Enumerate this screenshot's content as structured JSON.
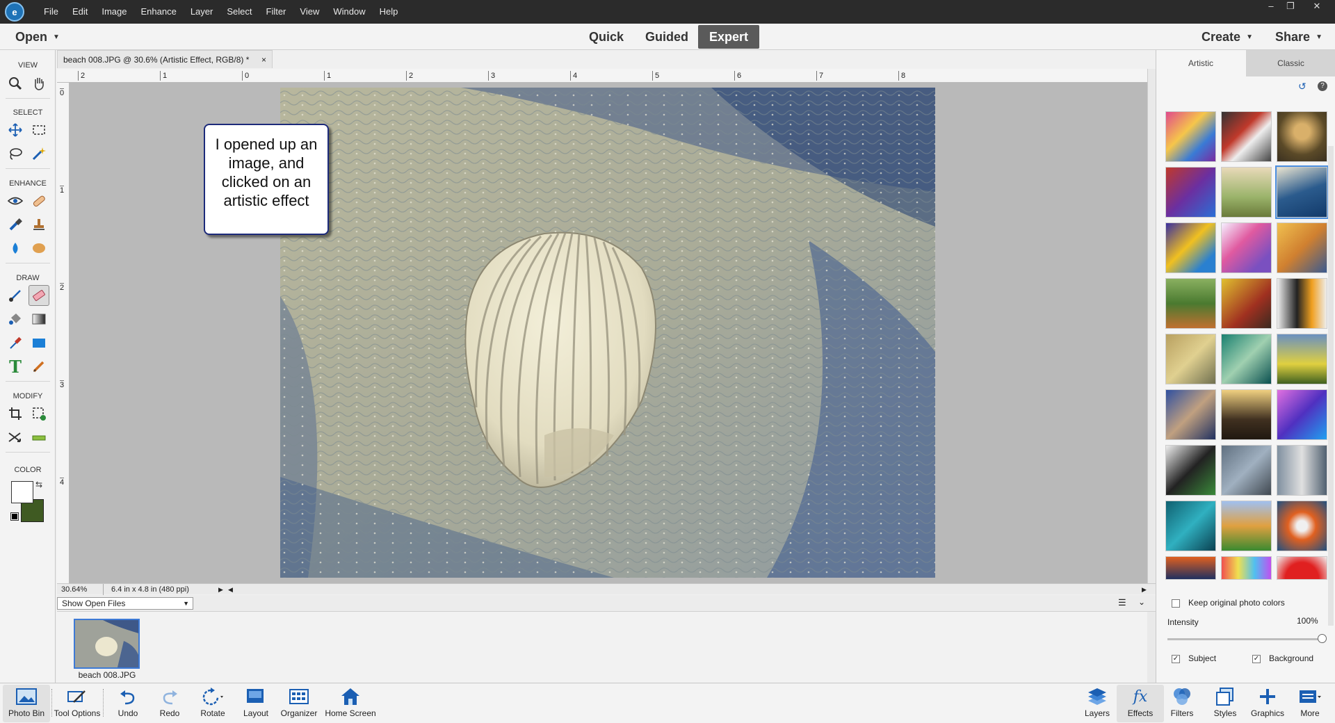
{
  "app": {
    "logo_text": "e"
  },
  "menu": [
    "File",
    "Edit",
    "Image",
    "Enhance",
    "Layer",
    "Select",
    "Filter",
    "View",
    "Window",
    "Help"
  ],
  "window_controls": [
    "–",
    "❐",
    "✕"
  ],
  "modebar": {
    "open_label": "Open",
    "modes": [
      "Quick",
      "Guided",
      "Expert"
    ],
    "active_mode": "Expert",
    "create_label": "Create",
    "share_label": "Share"
  },
  "toolbox": {
    "sections": [
      "VIEW",
      "SELECT",
      "ENHANCE",
      "DRAW",
      "MODIFY",
      "COLOR"
    ],
    "foreground_color": "#ffffff",
    "background_color": "#3f5a22"
  },
  "document": {
    "tab_title": "beach 008.JPG @ 30.6% (Artistic Effect, RGB/8) *",
    "close": "×"
  },
  "rulers": {
    "top": [
      "2",
      "1",
      "0",
      "1",
      "2",
      "3",
      "4",
      "5",
      "6",
      "7",
      "8"
    ],
    "left": [
      "0",
      "1",
      "2",
      "3",
      "4"
    ]
  },
  "callout": {
    "text": "I opened up an image, and clicked on an artistic effect"
  },
  "status": {
    "zoom": "30.64%",
    "doc_size": "6.4 in x 4.8 in (480 ppi)"
  },
  "photo_bin": {
    "select_value": "Show Open Files",
    "thumb_label": "beach 008.JPG"
  },
  "effects_panel": {
    "tabs": [
      "Artistic",
      "Classic"
    ],
    "active_tab": "Artistic",
    "keep_colors_label": "Keep original photo colors",
    "intensity_label": "Intensity",
    "intensity_value": "100%",
    "intensity": 1.0,
    "subject_label": "Subject",
    "background_label": "Background",
    "subject_checked": true,
    "background_checked": true
  },
  "bottom_left": [
    "Photo Bin",
    "Tool Options",
    "Undo",
    "Redo",
    "Rotate",
    "Layout",
    "Organizer",
    "Home Screen"
  ],
  "bottom_right": [
    "Layers",
    "Effects",
    "Filters",
    "Styles",
    "Graphics",
    "More"
  ]
}
